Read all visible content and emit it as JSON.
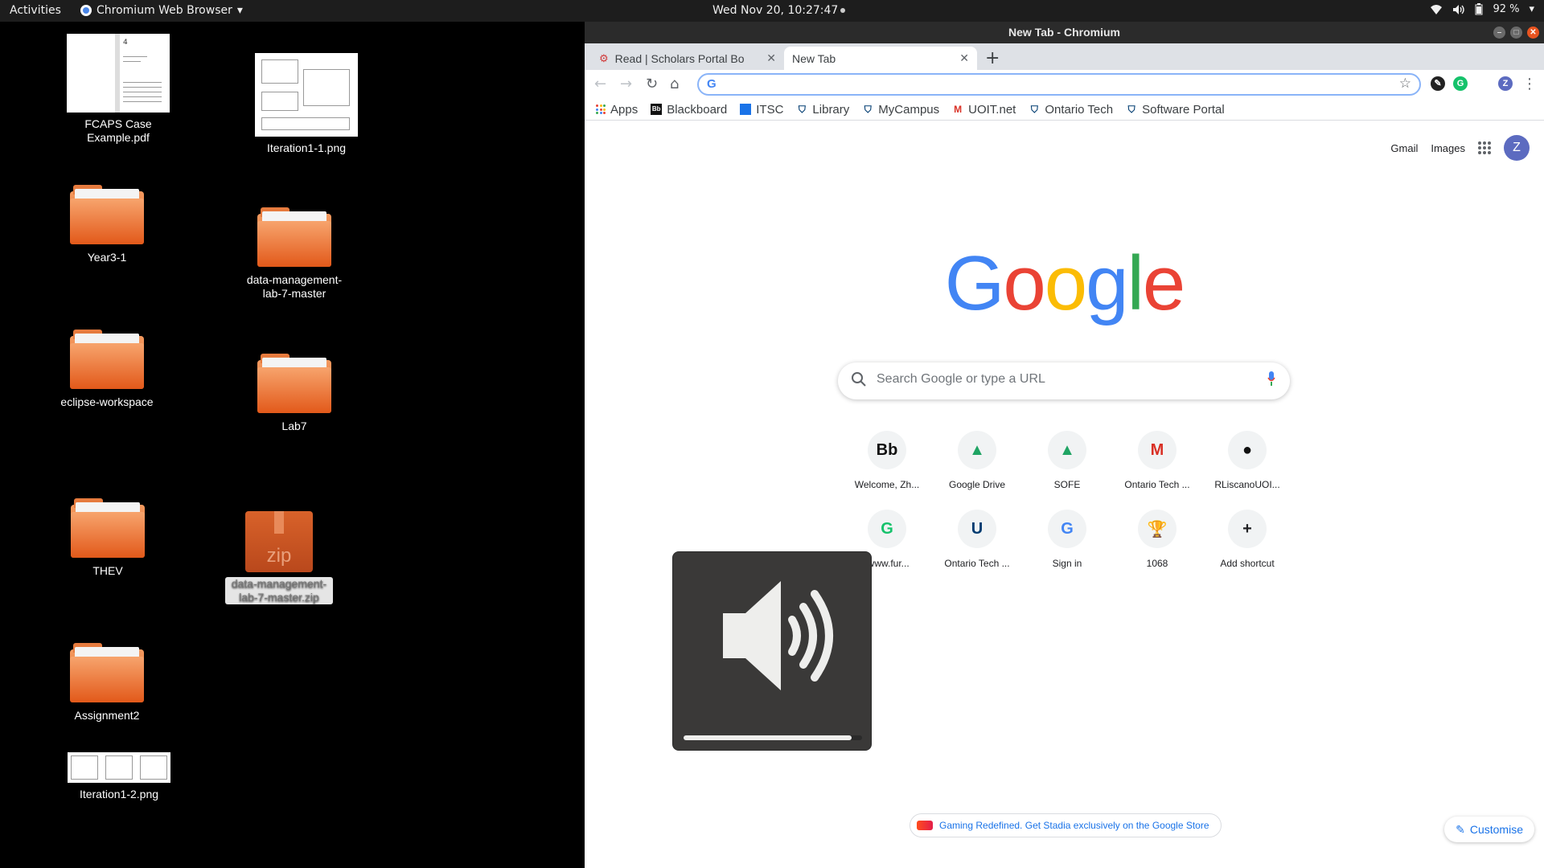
{
  "topbar": {
    "activities": "Activities",
    "app_name": "Chromium Web Browser",
    "clock": "Wed Nov 20, 10:27:47",
    "battery": "92 %"
  },
  "desktop": {
    "items": [
      {
        "label": "FCAPS Case Example.pdf",
        "kind": "pdf"
      },
      {
        "label": "Iteration1-1.png",
        "kind": "image"
      },
      {
        "label": "Year3-1",
        "kind": "folder"
      },
      {
        "label": "data-management-lab-7-master",
        "kind": "folder"
      },
      {
        "label": "eclipse-workspace",
        "kind": "folder"
      },
      {
        "label": "Lab7",
        "kind": "folder"
      },
      {
        "label": "THEV",
        "kind": "folder"
      },
      {
        "label": "data-management-lab-7-master.zip",
        "kind": "zip"
      },
      {
        "label": "Assignment2",
        "kind": "folder"
      },
      {
        "label": "Iteration1-2.png",
        "kind": "image"
      }
    ],
    "pdf_thumb_number": "4",
    "zip_text": "zip"
  },
  "window": {
    "title": "New Tab - Chromium",
    "tabs": [
      {
        "title": "Read | Scholars Portal Bo",
        "active": false
      },
      {
        "title": "New Tab",
        "active": true
      }
    ],
    "omnibox": {
      "value": "",
      "placeholder": ""
    },
    "profile_initial": "Z",
    "bookmarks": [
      {
        "label": "Apps",
        "icon": "apps-grid-icon"
      },
      {
        "label": "Blackboard",
        "icon": "blackboard-icon"
      },
      {
        "label": "ITSC",
        "icon": "itsc-icon"
      },
      {
        "label": "Library",
        "icon": "ontariotech-shield-icon"
      },
      {
        "label": "MyCampus",
        "icon": "ontariotech-shield-icon"
      },
      {
        "label": "UOIT.net",
        "icon": "gmail-icon"
      },
      {
        "label": "Ontario Tech",
        "icon": "ontariotech-shield-icon"
      },
      {
        "label": "Software Portal",
        "icon": "ontariotech-shield-icon"
      }
    ]
  },
  "ntp": {
    "gmail": "Gmail",
    "images": "Images",
    "avatar": "Z",
    "search_placeholder": "Search Google or type a URL",
    "shortcuts": [
      {
        "label": "Welcome, Zh...",
        "icon": "Bb",
        "color": "#111111"
      },
      {
        "label": "Google Drive",
        "icon": "▲",
        "color": "#1fa463"
      },
      {
        "label": "SOFE",
        "icon": "▲",
        "color": "#1fa463"
      },
      {
        "label": "Ontario Tech ...",
        "icon": "M",
        "color": "#d93025"
      },
      {
        "label": "RLiscanoUOI...",
        "icon": "●",
        "color": "#111111"
      },
      {
        "label": "/www.fur...",
        "icon": "G",
        "color": "#15c26b"
      },
      {
        "label": "Ontario Tech ...",
        "icon": "U",
        "color": "#003c71"
      },
      {
        "label": "Sign in",
        "icon": "G",
        "color": "#4285f4"
      },
      {
        "label": "1068",
        "icon": "🏆",
        "color": "#e0a030"
      },
      {
        "label": "Add shortcut",
        "icon": "+",
        "color": "#202124"
      }
    ],
    "promo": "Gaming Redefined. Get Stadia exclusively on the Google Store",
    "customise": "Customise"
  },
  "osd": {
    "volume_fraction": 0.94
  },
  "colors": {
    "google_blue": "#4285f4",
    "google_red": "#ea4335",
    "google_yellow": "#fbbc05",
    "google_green": "#34a853",
    "ubuntu_orange": "#e95420"
  }
}
